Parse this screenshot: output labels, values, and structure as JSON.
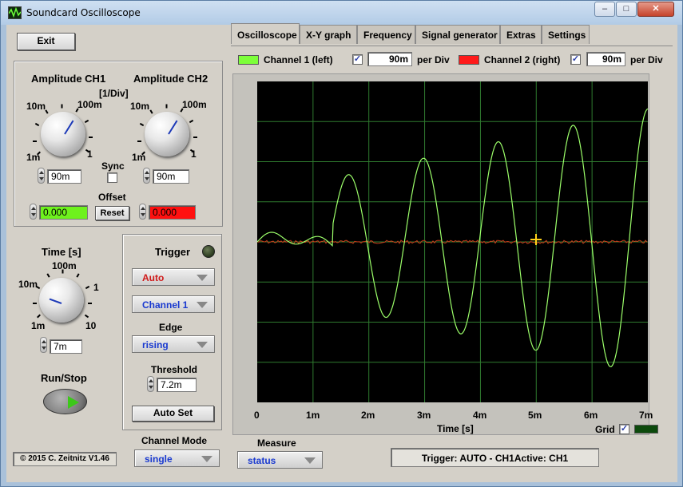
{
  "window": {
    "title": "Soundcard Oscilloscope",
    "min_label": "–",
    "max_label": "□",
    "close_label": "✕"
  },
  "left": {
    "exit_label": "Exit",
    "amp_ch1_label": "Amplitude CH1",
    "amp_ch2_label": "Amplitude CH2",
    "amp_unit_label": "[1/Div]",
    "amp_scale": {
      "s10m": "10m",
      "s100m": "100m",
      "s1m": "1m",
      "s1": "1"
    },
    "ch1_amp_value": "90m",
    "ch2_amp_value": "90m",
    "sync_label": "Sync",
    "sync_checked": false,
    "offset_label": "Offset",
    "ch1_offset_value": "0.000",
    "ch2_offset_value": "0.000",
    "reset_label": "Reset",
    "time_label": "Time [s]",
    "time_scale": {
      "s100m": "100m",
      "s10m": "10m",
      "s1": "1",
      "s1m": "1m",
      "s10": "10"
    },
    "time_value": "7m",
    "runstop_label": "Run/Stop",
    "copyright": "© 2015  C. Zeitnitz V1.46"
  },
  "trigger": {
    "title": "Trigger",
    "mode": "Auto",
    "channel": "Channel 1",
    "edge_label": "Edge",
    "edge": "rising",
    "threshold_label": "Threshold",
    "threshold_value": "7.2m",
    "autoset_label": "Auto Set"
  },
  "channel_mode": {
    "label": "Channel Mode",
    "value": "single"
  },
  "tabs": [
    "Oscilloscope",
    "X-Y graph",
    "Frequency",
    "Signal generator",
    "Extras",
    "Settings"
  ],
  "legend": {
    "ch1_label": "Channel 1 (left)",
    "ch1_checked": true,
    "ch1_value": "90m",
    "ch2_label": "Channel 2 (right)",
    "ch2_checked": true,
    "ch2_value": "90m",
    "per_div": "per Div",
    "ch1_color": "#7dff3a",
    "ch2_color": "#ff1a1a"
  },
  "plot": {
    "x_ticks": [
      "0",
      "1m",
      "2m",
      "3m",
      "4m",
      "5m",
      "6m",
      "7m"
    ],
    "x_label": "Time [s]",
    "grid_label": "Grid",
    "grid_checked": true,
    "ch1_trace_color": "#9cff6a",
    "ch2_trace_color": "#c83a1a",
    "grid_color": "#2f7a2f"
  },
  "measure": {
    "label": "Measure",
    "value": "status"
  },
  "status_text": "Trigger: AUTO - CH1Active: CH1"
}
